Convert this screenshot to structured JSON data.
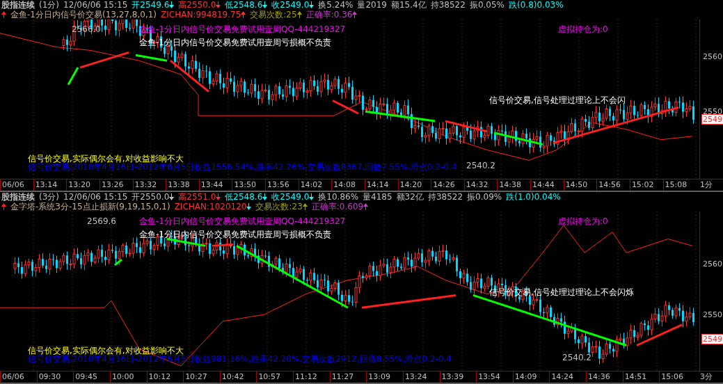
{
  "panels": [
    {
      "quote": [
        {
          "text": "股指连续",
          "color": "#c0c0c0"
        },
        {
          "text": "(1分)",
          "color": "#c0c0c0"
        },
        {
          "text": "12/06/06 15:15",
          "color": "#c0c0c0"
        },
        {
          "text": "开2549.6",
          "color": "#00ffff",
          "rising": false
        },
        {
          "text": "高2550.0",
          "color": "#ff3232",
          "rising": false
        },
        {
          "text": "低2548.6",
          "color": "#00ffff",
          "rising": false
        },
        {
          "text": "收2549.0",
          "color": "#00ffff",
          "rising": false
        },
        {
          "text": "换5.24%",
          "color": "#c0c0c0"
        },
        {
          "text": "量2019",
          "color": "#c0c0c0"
        },
        {
          "text": "额15.4亿",
          "color": "#c0c0c0"
        },
        {
          "text": "持38522",
          "color": "#c0c0c0"
        },
        {
          "text": "振0.05%",
          "color": "#c0c0c0"
        },
        {
          "text": "跌(0.8)0.03%",
          "color": "#00ffff"
        }
      ],
      "indicator": {
        "rising": true,
        "name": "金鱼-1分日内信号价交易(13,27,8,0,1)",
        "values": [
          {
            "text": "ZICHAN:994819.75",
            "color": "#ff3232",
            "rising": true
          },
          {
            "text": "交易次数:25",
            "color": "#a0a000",
            "rising": true
          },
          {
            "text": "正确率:0.36",
            "color": "#c040c0",
            "rising": true
          }
        ]
      },
      "overlays": [
        {
          "kind": "banner",
          "text": "金鱼-1分日内信号价交易免费试用壹周QQ-444219327"
        },
        {
          "kind": "disclaimer",
          "text": "金鱼-1分日内信号价交易免费试用壹周亏损概不负责"
        },
        {
          "kind": "position",
          "text": "虚拟持仓为:0"
        },
        {
          "kind": "note",
          "text": "信号价交易,信号处理过理论上不会闪"
        },
        {
          "kind": "warning",
          "text": "信号价交易,实际偶尔会有,对收益影响不大"
        },
        {
          "kind": "stats",
          "text": "信号价交易,2010年4月16日-2012年6月5日收益1556.54%,胜率42.26%,交易次数8367,回撤7.55%,滑点0.2-0.4"
        },
        {
          "kind": "high",
          "text": "2566.0"
        },
        {
          "kind": "low",
          "text": "2540.2"
        }
      ],
      "y_axis": [
        "2560",
        "2550"
      ],
      "last_price": "2549",
      "period": "1分",
      "x_axis": [
        "06/06",
        "13:14",
        "13:20",
        "13:26",
        "13:32",
        "13:38",
        "13:44",
        "13:50",
        "13:56",
        "14:02",
        "14:08",
        "14:14",
        "14:20",
        "14:26",
        "14:32",
        "14:38",
        "14:44",
        "14:50",
        "14:56",
        "15:02",
        "15:08"
      ]
    },
    {
      "quote": [
        {
          "text": "股指连续",
          "color": "#c0c0c0"
        },
        {
          "text": "(3分)",
          "color": "#c0c0c0"
        },
        {
          "text": "12/06/06 15:15",
          "color": "#c0c0c0"
        },
        {
          "text": "开2550.0",
          "color": "#c0c0c0",
          "rising": false
        },
        {
          "text": "高2551.0",
          "color": "#ff3232",
          "rising": false
        },
        {
          "text": "低2548.6",
          "color": "#00ffff",
          "rising": false
        },
        {
          "text": "收2549.0",
          "color": "#00ffff",
          "rising": false
        },
        {
          "text": "换10.86%",
          "color": "#c0c0c0"
        },
        {
          "text": "量4185",
          "color": "#c0c0c0"
        },
        {
          "text": "额32亿",
          "color": "#c0c0c0"
        },
        {
          "text": "持38522",
          "color": "#c0c0c0"
        },
        {
          "text": "振0.09%",
          "color": "#c0c0c0"
        },
        {
          "text": "跌(1.0)0.04%",
          "color": "#00ffff"
        }
      ],
      "indicator": {
        "rising": true,
        "name": "金字塔-系统3分-15点止损新(9,19,15,0,1)",
        "values": [
          {
            "text": "ZICHAN:1020120",
            "color": "#ff3232",
            "rising": false
          },
          {
            "text": "交易次数:23",
            "color": "#a0a000",
            "rising": true
          },
          {
            "text": "正确率:0.609",
            "color": "#c040c0",
            "rising": true
          }
        ]
      },
      "overlays": [
        {
          "kind": "banner",
          "text": "金鱼-1分日内信号价交易免费试用壹周QQ-444219327"
        },
        {
          "kind": "disclaimer",
          "text": "金鱼-1分日内信号价交易免费试用壹周亏损概不负责"
        },
        {
          "kind": "position",
          "text": "虚拟持仓为:0"
        },
        {
          "kind": "note",
          "text": "信号价交易,信号处理过理论上不会闪烁"
        },
        {
          "kind": "warning",
          "text": "信号价交易,实际偶尔会有,对收益影响不大"
        },
        {
          "kind": "stats",
          "text": "信号价交易,2010年4月16日-2012年6月5日收益981.16%,胜率42.20%,交易次数2912,回撤8.55%,滑点0.2-0.4"
        },
        {
          "kind": "high",
          "text": "2569.6"
        },
        {
          "kind": "low",
          "text": "2540.2"
        }
      ],
      "y_axis": [
        "2560",
        "2550"
      ],
      "last_price": "2549",
      "period": "3分",
      "x_axis": [
        "06/06",
        "09:30",
        "09:45",
        "10:00",
        "10:12",
        "10:27",
        "10:42",
        "10:57",
        "11:12",
        "11:27",
        "13:09",
        "13:24",
        "13:39",
        "13:54",
        "14:09",
        "14:24",
        "14:36",
        "14:51",
        "15:06"
      ]
    }
  ]
}
